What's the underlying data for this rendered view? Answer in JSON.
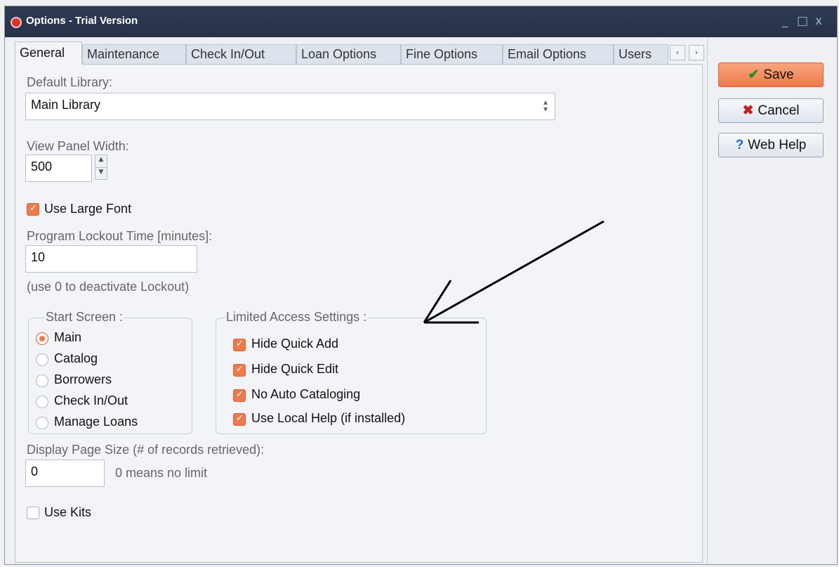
{
  "window": {
    "title": "Options - Trial Version",
    "controls": {
      "minimize": "_",
      "maximize": "□",
      "close": "x"
    }
  },
  "tabs": [
    {
      "label": "General",
      "active": true
    },
    {
      "label": "Maintenance"
    },
    {
      "label": "Check In/Out"
    },
    {
      "label": "Loan Options"
    },
    {
      "label": "Fine Options"
    },
    {
      "label": "Email Options"
    },
    {
      "label": "Users"
    }
  ],
  "tab_scroll": {
    "left": "‹",
    "right": "›"
  },
  "general": {
    "default_library_label": "Default Library:",
    "default_library_value": "Main Library",
    "view_panel_width_label": "View Panel Width:",
    "view_panel_width_value": "500",
    "use_large_font_label": "Use Large Font",
    "use_large_font_checked": true,
    "lockout_label": "Program Lockout Time [minutes]:",
    "lockout_value": "10",
    "lockout_hint": "(use 0 to deactivate Lockout)",
    "start_screen": {
      "legend": "Start Screen :",
      "options": [
        "Main",
        "Catalog",
        "Borrowers",
        "Check In/Out",
        "Manage Loans"
      ],
      "selected": "Main"
    },
    "limited_access": {
      "legend": "Limited Access Settings :",
      "items": [
        {
          "label": "Hide Quick Add",
          "checked": true
        },
        {
          "label": "Hide Quick Edit",
          "checked": true
        },
        {
          "label": "No Auto Cataloging",
          "checked": true
        },
        {
          "label": "Use Local Help (if installed)",
          "checked": true
        }
      ]
    },
    "page_size_label": "Display Page Size (# of records retrieved):",
    "page_size_value": "0",
    "page_size_hint": "0 means no limit",
    "use_kits_label": "Use Kits",
    "use_kits_checked": false
  },
  "actions": {
    "save": "Save",
    "cancel": "Cancel",
    "web_help": "Web Help"
  },
  "icons": {
    "app": "options-app-icon",
    "save": "checkmark-icon",
    "cancel": "red-x-icon",
    "help": "question-mark-icon"
  },
  "colors": {
    "accent": "#ef7a4c",
    "titlebar": "#2f3b52",
    "cancel_icon": "#c21f1f",
    "help_icon": "#1e6fd0"
  }
}
